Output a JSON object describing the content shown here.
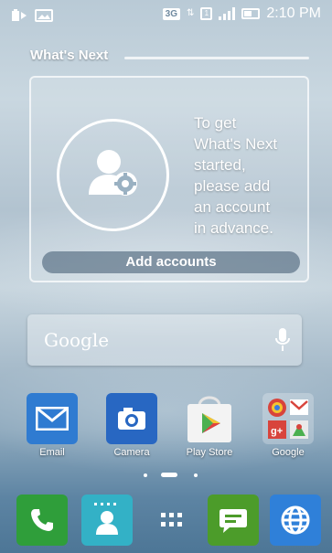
{
  "status_bar": {
    "network": "3G",
    "time": "2:10 PM"
  },
  "whats_next": {
    "title": "What's Next",
    "message_lines": [
      "To get",
      "What's Next",
      "started,",
      "please add",
      "an account",
      "in advance."
    ],
    "button_label": "Add accounts"
  },
  "search": {
    "placeholder": "Google"
  },
  "apps": [
    {
      "label": "Email"
    },
    {
      "label": "Camera"
    },
    {
      "label": "Play Store"
    },
    {
      "label": "Google"
    }
  ],
  "colors": {
    "email": "#2f7bd1",
    "camera": "#2867c2",
    "phone": "#2f9e3a",
    "contacts": "#33b1c6",
    "messages": "#4c9c2a",
    "browser": "#2f80d9"
  }
}
